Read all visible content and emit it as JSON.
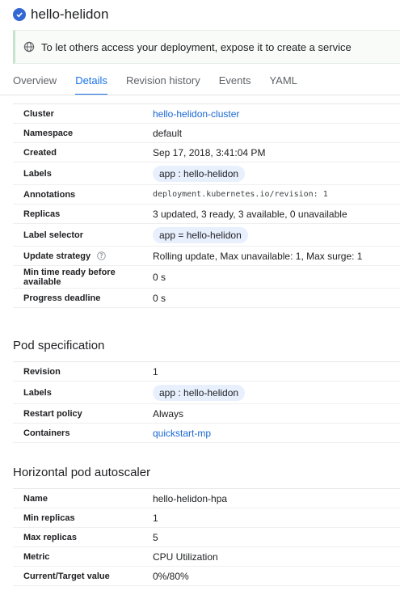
{
  "header": {
    "title": "hello-helidon"
  },
  "banner": {
    "text": "To let others access your deployment, expose it to create a service"
  },
  "tabs": [
    "Overview",
    "Details",
    "Revision history",
    "Events",
    "YAML"
  ],
  "details": {
    "cluster": {
      "label": "Cluster",
      "value": "hello-helidon-cluster"
    },
    "namespace": {
      "label": "Namespace",
      "value": "default"
    },
    "created": {
      "label": "Created",
      "value": "Sep 17, 2018, 3:41:04 PM"
    },
    "labels": {
      "label": "Labels",
      "value": "app : hello-helidon"
    },
    "annotations": {
      "label": "Annotations",
      "value": "deployment.kubernetes.io/revision: 1"
    },
    "replicas": {
      "label": "Replicas",
      "value": "3 updated, 3 ready, 3 available, 0 unavailable"
    },
    "label_selector": {
      "label": "Label selector",
      "value": "app = hello-helidon"
    },
    "update_strategy": {
      "label": "Update strategy",
      "value": "Rolling update, Max unavailable: 1, Max surge: 1"
    },
    "min_ready": {
      "label": "Min time ready before available",
      "value": "0 s"
    },
    "progress_deadline": {
      "label": "Progress deadline",
      "value": "0 s"
    }
  },
  "pod_spec": {
    "title": "Pod specification",
    "revision": {
      "label": "Revision",
      "value": "1"
    },
    "labels": {
      "label": "Labels",
      "value": "app : hello-helidon"
    },
    "restart_policy": {
      "label": "Restart policy",
      "value": "Always"
    },
    "containers": {
      "label": "Containers",
      "value": "quickstart-mp"
    }
  },
  "hpa": {
    "title": "Horizontal pod autoscaler",
    "name": {
      "label": "Name",
      "value": "hello-helidon-hpa"
    },
    "min_replicas": {
      "label": "Min replicas",
      "value": "1"
    },
    "max_replicas": {
      "label": "Max replicas",
      "value": "5"
    },
    "metric": {
      "label": "Metric",
      "value": "CPU Utilization"
    },
    "current_target": {
      "label": "Current/Target value",
      "value": "0%/80%"
    }
  },
  "colors": {
    "accent": "#1a73e8",
    "link": "#1967d2",
    "chip": "#e8f0fe",
    "status": "#3367d6"
  },
  "icons": {
    "status": "check-circle-icon",
    "banner": "globe-icon",
    "help": "help-icon"
  }
}
